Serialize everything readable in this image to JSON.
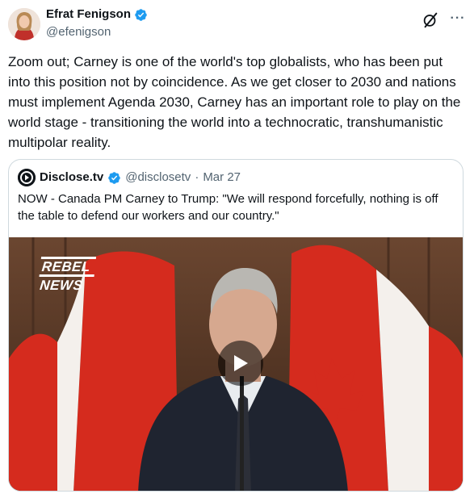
{
  "author": {
    "name": "Efrat Fenigson",
    "handle": "@efenigson"
  },
  "tweet": {
    "text": "Zoom out; Carney is one of the world's top globalists, who has been put into this position not by coincidence. As we get closer to 2030 and nations must implement Agenda 2030, Carney has an important role to play on the world stage - transitioning the world into a technocratic, transhumanistic multipolar reality."
  },
  "quote": {
    "name": "Disclose.tv",
    "handle": "@disclosetv",
    "separator": "·",
    "date": "Mar 27",
    "text": "NOW - Canada PM Carney to Trump: \"We will respond forcefully, nothing is off the table to defend our workers and our country.\"",
    "video": {
      "watermark_line1": "REBEL",
      "watermark_line2": "NEWS"
    }
  },
  "colors": {
    "verified": "#1d9bf0",
    "secondary_text": "#536471",
    "border": "#cfd9de",
    "flag_red": "#d52b1e"
  },
  "icons": [
    "verified-badge-icon",
    "grok-icon",
    "more-icon",
    "disclose-logo-icon",
    "play-icon"
  ]
}
